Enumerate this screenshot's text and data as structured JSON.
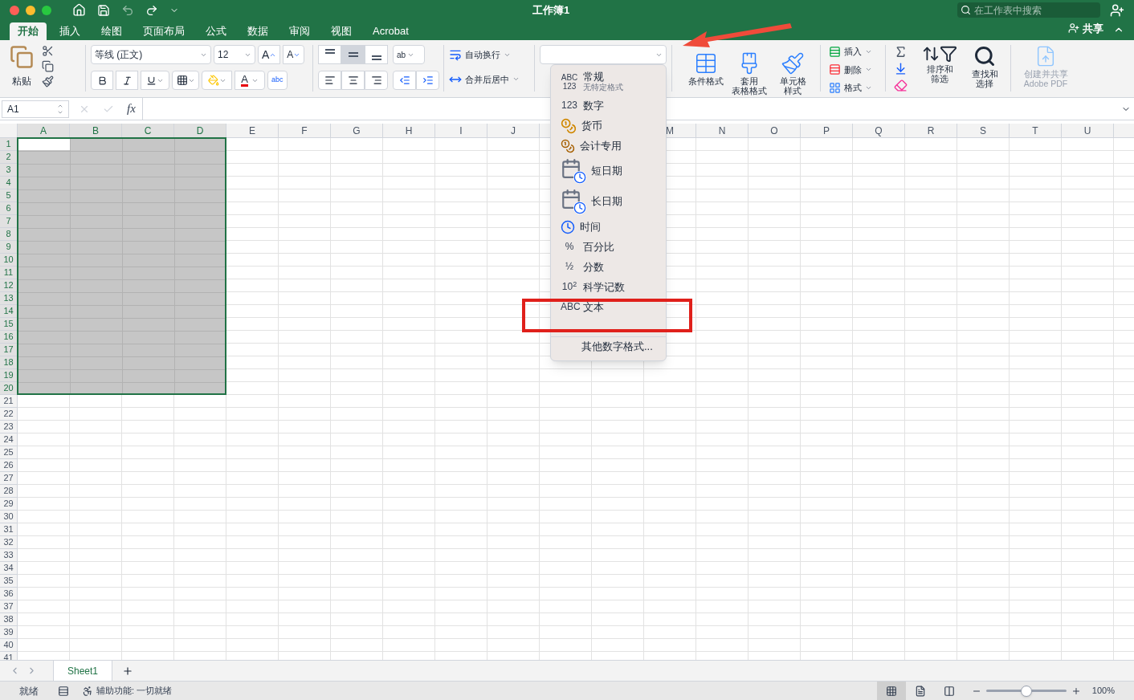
{
  "window": {
    "title": "工作簿1",
    "search_placeholder": "在工作表中搜索"
  },
  "tabs": [
    {
      "label": "开始",
      "selected": true
    },
    {
      "label": "插入",
      "selected": false
    },
    {
      "label": "绘图",
      "selected": false
    },
    {
      "label": "页面布局",
      "selected": false
    },
    {
      "label": "公式",
      "selected": false
    },
    {
      "label": "数据",
      "selected": false
    },
    {
      "label": "审阅",
      "selected": false
    },
    {
      "label": "视图",
      "selected": false
    },
    {
      "label": "Acrobat",
      "selected": false
    }
  ],
  "share": "共享",
  "ribbon": {
    "paste": "粘贴",
    "font": "等线 (正文)",
    "size": "12",
    "grow_font": "A",
    "shrink_font": "A",
    "font_color": "A",
    "phonetic": "abc",
    "orientation": "ab",
    "vertical_align": [
      {
        "kind": "top",
        "selected": false
      },
      {
        "kind": "middle",
        "selected": true
      },
      {
        "kind": "bottom",
        "selected": false
      }
    ],
    "wrap": "自动换行",
    "merge": "合并后居中",
    "styles": [
      {
        "kind": "conditional",
        "lines": [
          "条件格式"
        ]
      },
      {
        "kind": "table",
        "lines": [
          "套用",
          "表格格式"
        ]
      },
      {
        "kind": "cell",
        "lines": [
          "单元格",
          "样式"
        ]
      }
    ],
    "cells": [
      {
        "kind": "insert",
        "label": "插入"
      },
      {
        "kind": "delete",
        "label": "删除"
      },
      {
        "kind": "format",
        "label": "格式"
      }
    ],
    "editing": [
      {
        "kind": "sort",
        "lines": [
          "排序和",
          "筛选"
        ]
      },
      {
        "kind": "find",
        "lines": [
          "查找和",
          "选择"
        ]
      }
    ],
    "pdf": {
      "lines": [
        "创建并共享",
        "Adobe PDF"
      ],
      "disabled": true
    }
  },
  "name_box": "A1",
  "function_label": "fx",
  "columns": [
    {
      "label": "A",
      "selected": true
    },
    {
      "label": "B",
      "selected": true
    },
    {
      "label": "C",
      "selected": true
    },
    {
      "label": "D",
      "selected": true
    },
    {
      "label": "E",
      "selected": false
    },
    {
      "label": "F",
      "selected": false
    },
    {
      "label": "G",
      "selected": false
    },
    {
      "label": "H",
      "selected": false
    },
    {
      "label": "I",
      "selected": false
    },
    {
      "label": "J",
      "selected": false
    },
    {},
    {},
    {
      "label": "M",
      "selected": false
    },
    {
      "label": "N",
      "selected": false
    },
    {
      "label": "O",
      "selected": false
    },
    {
      "label": "P",
      "selected": false
    },
    {
      "label": "Q",
      "selected": false
    },
    {
      "label": "R",
      "selected": false
    },
    {
      "label": "S",
      "selected": false
    },
    {
      "label": "T",
      "selected": false
    },
    {
      "label": "U",
      "selected": false
    }
  ],
  "rows": [
    {
      "label": "1",
      "selected": true
    },
    {
      "label": "2",
      "selected": true
    },
    {
      "label": "3",
      "selected": true
    },
    {
      "label": "4",
      "selected": true
    },
    {
      "label": "5",
      "selected": true
    },
    {
      "label": "6",
      "selected": true
    },
    {
      "label": "7",
      "selected": true
    },
    {
      "label": "8",
      "selected": true
    },
    {
      "label": "9",
      "selected": true
    },
    {
      "label": "10",
      "selected": true
    },
    {
      "label": "11",
      "selected": true
    },
    {
      "label": "12",
      "selected": true
    },
    {
      "label": "13",
      "selected": true
    },
    {
      "label": "14",
      "selected": true
    },
    {
      "label": "15",
      "selected": true
    },
    {
      "label": "16",
      "selected": true
    },
    {
      "label": "17",
      "selected": true
    },
    {
      "label": "18",
      "selected": true
    },
    {
      "label": "19",
      "selected": true
    },
    {
      "label": "20",
      "selected": true
    },
    {
      "label": "21",
      "selected": false
    },
    {
      "label": "22",
      "selected": false
    },
    {
      "label": "23",
      "selected": false
    },
    {
      "label": "24",
      "selected": false
    },
    {
      "label": "25",
      "selected": false
    },
    {
      "label": "26",
      "selected": false
    },
    {
      "label": "27",
      "selected": false
    },
    {
      "label": "28",
      "selected": false
    },
    {
      "label": "29",
      "selected": false
    },
    {
      "label": "30",
      "selected": false
    },
    {
      "label": "31",
      "selected": false
    },
    {
      "label": "32",
      "selected": false
    },
    {
      "label": "33",
      "selected": false
    },
    {
      "label": "34",
      "selected": false
    },
    {
      "label": "35",
      "selected": false
    },
    {
      "label": "36",
      "selected": false
    },
    {
      "label": "37",
      "selected": false
    },
    {
      "label": "38",
      "selected": false
    },
    {
      "label": "39",
      "selected": false
    },
    {
      "label": "40",
      "selected": false
    },
    {
      "label": "41",
      "selected": false
    }
  ],
  "format_menu": [
    {
      "kind": "plain",
      "icon_text": "ABC 123",
      "label": "常规",
      "note": "无特定格式"
    },
    {
      "kind": "plain",
      "icon_text": "123",
      "label": "数字"
    },
    {
      "kind": "coins",
      "label": "货币"
    },
    {
      "kind": "accounting",
      "label": "会计专用"
    },
    {
      "kind": "date",
      "label": "短日期"
    },
    {
      "kind": "date",
      "label": "长日期"
    },
    {
      "kind": "time",
      "label": "时间"
    },
    {
      "kind": "plain",
      "icon_text": "%",
      "label": "百分比"
    },
    {
      "kind": "plain",
      "icon_text": "½",
      "label": "分数"
    },
    {
      "kind": "plain",
      "icon_text": "10$^{2}$",
      "label": "科学记数"
    },
    {
      "kind": "plain",
      "icon_text": "ABC",
      "label": "文本"
    },
    {
      "kind": "more",
      "label": "其他数字格式..."
    }
  ],
  "sheets": [
    {
      "label": "Sheet1",
      "selected": true
    }
  ],
  "status": {
    "ready": "就绪",
    "accessibility": "辅助功能: 一切就绪",
    "views": [
      {
        "kind": "normal",
        "selected": true
      },
      {
        "kind": "layout",
        "selected": false
      },
      {
        "kind": "break",
        "selected": false
      }
    ],
    "zoom": {
      "level": 0.5
    },
    "zoom_text": "100%"
  }
}
